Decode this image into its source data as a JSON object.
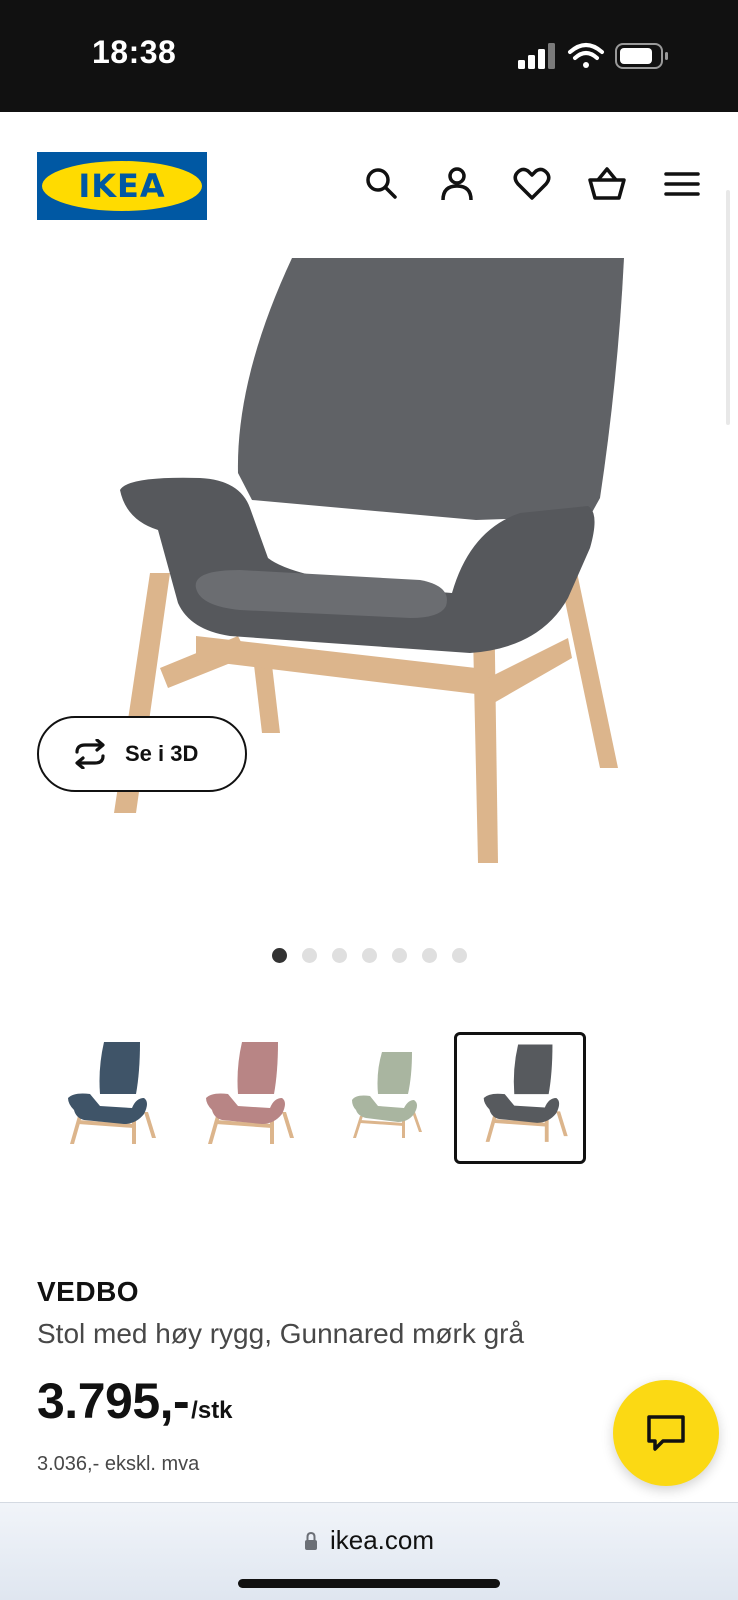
{
  "status_bar": {
    "time": "18:38",
    "icons": [
      "signal-icon",
      "wifi-icon",
      "battery-icon"
    ]
  },
  "header": {
    "logo_text": "IKEA",
    "icons": [
      "search-icon",
      "account-icon",
      "favorites-heart-icon",
      "shopping-basket-icon",
      "menu-hamburger-icon"
    ]
  },
  "gallery": {
    "view_3d_label": "Se i 3D",
    "view_3d_icon": "rotate-3d-icon",
    "dot_count": 7,
    "active_dot": 0,
    "thumbnails": [
      {
        "color_name": "dark-blue",
        "color": "#3f5468",
        "selected": false
      },
      {
        "color_name": "pink",
        "color": "#b88585",
        "selected": false
      },
      {
        "color_name": "light-green",
        "color": "#a9b5a0",
        "selected": false
      },
      {
        "color_name": "dark-grey",
        "color": "#575a5e",
        "selected": true
      }
    ]
  },
  "product": {
    "name": "VEDBO",
    "description": "Stol med høy rygg, Gunnared mørk grå",
    "price": "3.795,-",
    "price_unit": "/stk",
    "price_excl_vat": "3.036,- ekskl. mva"
  },
  "chat": {
    "icon": "chat-bubble-icon",
    "color": "#fbd914"
  },
  "browser": {
    "url": "ikea.com",
    "lock_icon": "lock-icon"
  },
  "colors": {
    "brand_blue": "#0058a3",
    "brand_yellow": "#ffdb00",
    "chair_fabric": "#5b5d61",
    "wood": "#dcb58c"
  }
}
